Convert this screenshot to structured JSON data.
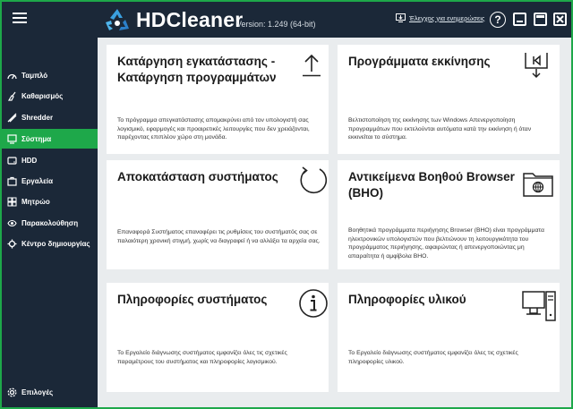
{
  "app": {
    "name": "HDCleaner",
    "version": "Version: 1.249 (64-bit)",
    "update_link": "Έλεγχος για ενημερώσεις",
    "help": "?",
    "accent": "#1ea84a",
    "bg_dark": "#1b2838"
  },
  "sidebar": {
    "items": [
      {
        "label": "Ταμπλό",
        "icon": "dashboard-icon"
      },
      {
        "label": "Καθαρισμός",
        "icon": "clean-icon"
      },
      {
        "label": "Shredder",
        "icon": "shredder-icon"
      },
      {
        "label": "Σύστημα",
        "icon": "system-icon",
        "active": true
      },
      {
        "label": "HDD",
        "icon": "hdd-icon"
      },
      {
        "label": "Εργαλεία",
        "icon": "tools-icon"
      },
      {
        "label": "Μητρώο",
        "icon": "registry-icon"
      },
      {
        "label": "Παρακολούθηση",
        "icon": "monitor-icon"
      },
      {
        "label": "Κέντρο δημιουργίας",
        "icon": "creation-center-icon"
      }
    ],
    "options": {
      "label": "Επιλογές",
      "icon": "options-icon"
    }
  },
  "cards": [
    {
      "title": "Κατάργηση εγκατάστασης - Κατάργηση προγραμμάτων",
      "icon": "upload-icon",
      "desc": "Το πρόγραμμα απεγκατάστασης απομακρύνει από τον υπολογιστή σας λογισμικό, εφαρμογές και προαιρετικές λειτουργίες που δεν χρειάζονται, παρέχοντας επιπλέον χώρο στη μονάδα."
    },
    {
      "title": "Προγράμματα εκκίνησης",
      "icon": "startup-icon",
      "desc": "Βελτιστοποίηση της εκκίνησης των Windows Απενεργοποίηση προγραμμάτων που εκτελούνται αυτόματα κατά την εκκίνηση ή όταν εκκινείται το σύστημα."
    },
    {
      "title": "Αποκατάσταση συστήματος",
      "icon": "restore-icon",
      "desc": "Επαναφορά Συστήματος επαναφέρει τις ρυθμίσεις του συστήματός σας σε παλαιότερη χρονική στιγμή, χωρίς να διαγραφεί ή να αλλάξει τα αρχεία σας."
    },
    {
      "title": "Αντικείμενα Βοηθού Browser (BHO)",
      "icon": "browser-folder-icon",
      "desc": "Βοηθητικά προγράμματα περιήγησης Browser (BHO) είναι προγράμματα ηλεκτρονικών υπολογιστών που βελτιώνουν τη λειτουργικότητα του προγράμματος περιήγησης, αφαιρώντας ή απενεργοποιώντας μη απαραίτητα ή αμφίβολα BHO."
    },
    {
      "title": "Πληροφορίες συστήματος",
      "icon": "info-icon",
      "desc": "Το Εργαλείο διάγνωσης συστήματος εμφανίζει όλες τις σχετικές παραμέτρους του συστήματος και πληροφορίες λογισμικού."
    },
    {
      "title": "Πληροφορίες υλικού",
      "icon": "hardware-icon",
      "desc": "Το Εργαλείο διάγνωσης συστήματος εμφανίζει όλες τις σχετικές πληροφορίες υλικού."
    }
  ]
}
